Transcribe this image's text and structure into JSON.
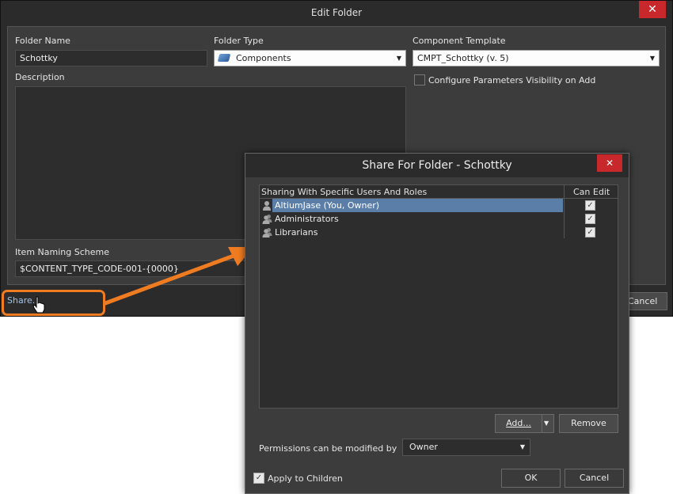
{
  "edit_folder": {
    "title": "Edit Folder",
    "close_glyph": "✕",
    "folder_name_label": "Folder Name",
    "folder_name_value": "Schottky",
    "folder_type_label": "Folder Type",
    "folder_type_value": "Components",
    "folder_type_icon": "components-icon",
    "component_template_label": "Component Template",
    "component_template_value": "CMPT_Schottky (v. 5)",
    "configure_visibility_label": "Configure Parameters Visibility on Add",
    "configure_visibility_checked": false,
    "description_label": "Description",
    "description_value": "",
    "item_naming_label": "Item Naming Scheme",
    "item_naming_value": "$CONTENT_TYPE_CODE-001-{0000}",
    "share_link": "Share...",
    "cancel_partial": "Cancel"
  },
  "share_dialog": {
    "title": "Share For Folder - Schottky",
    "close_glyph": "✕",
    "columns": [
      "Sharing With Specific Users And Roles",
      "Can Edit"
    ],
    "rows": [
      {
        "name": "AltiumJase (You, Owner)",
        "can_edit": true,
        "selected": true,
        "icon": "user-icon"
      },
      {
        "name": "Administrators",
        "can_edit": true,
        "selected": false,
        "icon": "group-icon"
      },
      {
        "name": "Librarians",
        "can_edit": true,
        "selected": false,
        "icon": "group-icon"
      }
    ],
    "add_button": "Add...",
    "remove_button": "Remove",
    "permissions_label": "Permissions can be modified by",
    "permissions_value": "Owner",
    "apply_children_label": "Apply to Children",
    "apply_children_checked": true,
    "ok_button": "OK",
    "cancel_button": "Cancel"
  },
  "annotation": {
    "highlight_color": "#f07c22"
  }
}
